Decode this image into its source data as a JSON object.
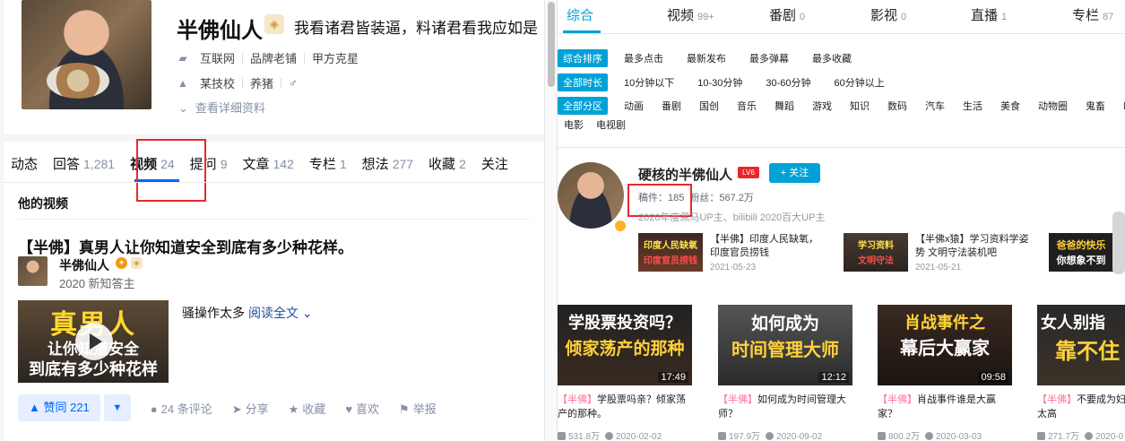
{
  "zhihu": {
    "profile": {
      "name": "半佛仙人",
      "badge_glyph": "◈",
      "headline": "我看诸君皆装逼，料诸君看我应如是",
      "industry_icon": "briefcase-icon",
      "industry": [
        "互联网",
        "品牌老铺",
        "甲方克星"
      ],
      "education_icon": "graduation-cap-icon",
      "education": [
        "某技校",
        "养猪"
      ],
      "gender": "♂",
      "more_label": "查看详细资料",
      "more_glyph": "⌄"
    },
    "tabs": [
      {
        "label": "动态",
        "count": ""
      },
      {
        "label": "回答",
        "count": "1,281"
      },
      {
        "label": "视频",
        "count": "24"
      },
      {
        "label": "提问",
        "count": "9"
      },
      {
        "label": "文章",
        "count": "142"
      },
      {
        "label": "专栏",
        "count": "1"
      },
      {
        "label": "想法",
        "count": "277"
      },
      {
        "label": "收藏",
        "count": "2"
      },
      {
        "label": "关注",
        "count": ""
      }
    ],
    "section_title": "他的视频",
    "post": {
      "title": "【半佛】真男人让你知道安全到底有多少种花样。",
      "author": "半佛仙人",
      "author_desc": "2020 新知答主",
      "thumb_lines": [
        "真男人",
        "让你知道安全",
        "到底有多少种花样"
      ],
      "excerpt": "骚操作太多",
      "read_more": "阅读全文 ⌄",
      "vote_label": "▲ 赞同 221",
      "vote_down": "▼",
      "actions": [
        {
          "glyph": "●",
          "label": "24 条评论"
        },
        {
          "glyph": "➤",
          "label": "分享"
        },
        {
          "glyph": "★",
          "label": "收藏"
        },
        {
          "glyph": "♥",
          "label": "喜欢"
        },
        {
          "glyph": "⚑",
          "label": "举报"
        }
      ]
    }
  },
  "bili": {
    "tabs": [
      {
        "label": "综合",
        "count": ""
      },
      {
        "label": "视频",
        "count": "99+"
      },
      {
        "label": "番剧",
        "count": "0"
      },
      {
        "label": "影视",
        "count": "0"
      },
      {
        "label": "直播",
        "count": "1"
      },
      {
        "label": "专栏",
        "count": "87"
      }
    ],
    "sort": {
      "active": "综合排序",
      "options": [
        "最多点击",
        "最新发布",
        "最多弹幕",
        "最多收藏"
      ]
    },
    "duration": {
      "active": "全部时长",
      "options": [
        "10分钟以下",
        "10-30分钟",
        "30-60分钟",
        "60分钟以上"
      ]
    },
    "zone": {
      "active": "全部分区",
      "options": [
        "动画",
        "番剧",
        "国创",
        "音乐",
        "舞蹈",
        "游戏",
        "知识",
        "数码",
        "汽车",
        "生活",
        "美食",
        "动物圈",
        "鬼畜",
        "时"
      ],
      "options2": [
        "电影",
        "电视剧"
      ]
    },
    "up": {
      "name": "硬核的半佛仙人",
      "level": "LV6",
      "follow_label": "+ 关注",
      "works": "稿件：185",
      "fans": "粉丝：567.2万",
      "honor": "2020年度黑马UP主、bilibili 2020百大UP主"
    },
    "mini_videos": [
      {
        "thumb": [
          "印度人民缺氧",
          "印度官员捞钱"
        ],
        "title": "【半佛】印度人民缺氧，印度官员捞钱",
        "date": "2021-05-23"
      },
      {
        "thumb": [
          "学习资料",
          "文明守法"
        ],
        "title": "【半佛x猿】学习资料学姿势 文明守法装机吧",
        "date": "2021-05-21"
      },
      {
        "thumb": [
          "爸爸的快乐",
          "你想象不到"
        ],
        "title": "",
        "date": ""
      }
    ],
    "videos": [
      {
        "thumb": [
          "学股票投资吗？",
          "倾家荡产的那种"
        ],
        "duration": "17:49",
        "tag": "【半佛】",
        "title": "学股票吗亲？倾家荡产的那种。",
        "views": "531.8万",
        "date": "2020-02-02"
      },
      {
        "thumb": [
          "如何成为",
          "时间管理大师"
        ],
        "duration": "12:12",
        "tag": "【半佛】",
        "title": "如何成为时间管理大师？",
        "views": "197.9万",
        "date": "2020-09-02"
      },
      {
        "thumb": [
          "肖战事件之",
          "幕后大赢家"
        ],
        "duration": "09:58",
        "tag": "【半佛】",
        "title": "肖战事件谁是大赢家？",
        "views": "800.2万",
        "date": "2020-03-03"
      },
      {
        "thumb": [
          "女人别指",
          "靠不住"
        ],
        "duration": "",
        "tag": "【半佛】",
        "title": "不要成为妇女，风险太高",
        "views": "271.7万",
        "date": "2020-0"
      }
    ]
  }
}
